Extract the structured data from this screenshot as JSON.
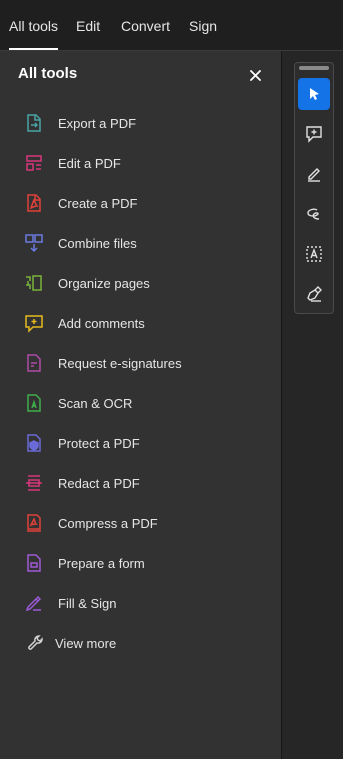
{
  "tabs": [
    {
      "label": "All tools",
      "active": true
    },
    {
      "label": "Edit",
      "active": false
    },
    {
      "label": "Convert",
      "active": false
    },
    {
      "label": "Sign",
      "active": false
    }
  ],
  "panel": {
    "title": "All tools",
    "close_icon": "close-icon",
    "items": [
      {
        "label": "Export a PDF",
        "icon": "export-pdf-icon",
        "color": "#4aa3a6"
      },
      {
        "label": "Edit a PDF",
        "icon": "edit-pdf-icon",
        "color": "#d8367a"
      },
      {
        "label": "Create a PDF",
        "icon": "create-pdf-icon",
        "color": "#e0413a"
      },
      {
        "label": "Combine files",
        "icon": "combine-files-icon",
        "color": "#6a7ae0"
      },
      {
        "label": "Organize pages",
        "icon": "organize-pages-icon",
        "color": "#7bb33a"
      },
      {
        "label": "Add comments",
        "icon": "add-comments-icon",
        "color": "#e6b91e"
      },
      {
        "label": "Request e-signatures",
        "icon": "request-esignatures-icon",
        "color": "#b04aa6"
      },
      {
        "label": "Scan & OCR",
        "icon": "scan-ocr-icon",
        "color": "#3fae4a"
      },
      {
        "label": "Protect a PDF",
        "icon": "protect-pdf-icon",
        "color": "#6a6ad8"
      },
      {
        "label": "Redact a PDF",
        "icon": "redact-pdf-icon",
        "color": "#d8367a"
      },
      {
        "label": "Compress a PDF",
        "icon": "compress-pdf-icon",
        "color": "#e0413a"
      },
      {
        "label": "Prepare a form",
        "icon": "prepare-form-icon",
        "color": "#a05ad8"
      },
      {
        "label": "Fill & Sign",
        "icon": "fill-sign-icon",
        "color": "#9a5ad8"
      },
      {
        "label": "View more",
        "icon": "wrench-icon",
        "color": "#d0d0d0"
      }
    ]
  },
  "toolbar": {
    "tools": [
      {
        "icon": "select-pointer-icon",
        "active": true
      },
      {
        "icon": "add-comment-icon",
        "active": false
      },
      {
        "icon": "highlight-icon",
        "active": false
      },
      {
        "icon": "draw-freeform-icon",
        "active": false
      },
      {
        "icon": "add-text-icon",
        "active": false
      },
      {
        "icon": "fill-sign-tool-icon",
        "active": false
      }
    ]
  },
  "colors": {
    "accent": "#1473e6",
    "panel_bg": "#323232",
    "app_bg": "#1f1f1f"
  }
}
